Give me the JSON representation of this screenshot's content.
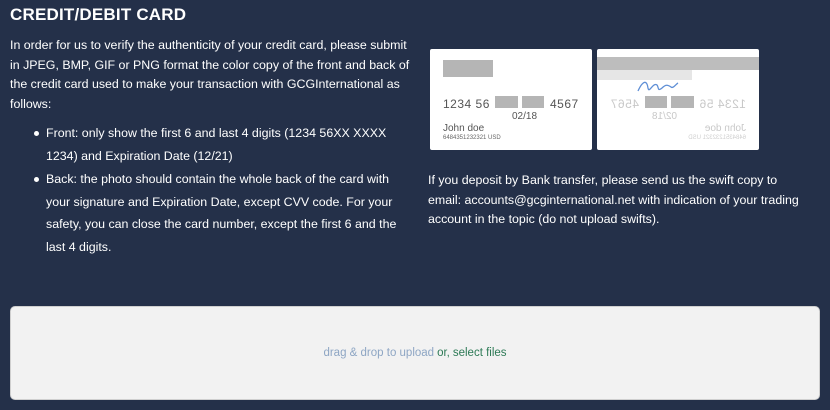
{
  "header": {
    "title": "CREDIT/DEBIT CARD"
  },
  "instructions": {
    "intro": "In order for us to verify the authenticity of your credit card, please submit in JPEG, BMP, GIF or PNG format the color copy of the front and back of the credit card used to make your transaction with GCGInternational as follows:",
    "bullets": [
      "Front: only show the first 6 and last 4 digits (1234 56XX XXXX 1234) and Expiration Date (12/21)",
      "Back: the photo should contain the whole back of the card with your signature and Expiration Date, except CVV code. For your safety, you can close the card number, except the first 6 and the last 4 digits."
    ]
  },
  "card_example": {
    "number_first": "1234 56",
    "number_last": "4567",
    "expiry": "02/18",
    "holder": "John doe",
    "small_number": "6484351232321 USD"
  },
  "deposit": {
    "text": "If you deposit by Bank transfer, please send us the swift copy to email: accounts@gcginternational.net with indication of your trading account in the topic (do not upload swifts)."
  },
  "upload": {
    "prompt": "drag & drop to upload",
    "or": "or,",
    "select": "select files"
  },
  "colors": {
    "background": "#243049",
    "dropzone": "#f2f2f2",
    "link_green": "#2d7a56",
    "prompt_blue": "#8ea6c4"
  }
}
